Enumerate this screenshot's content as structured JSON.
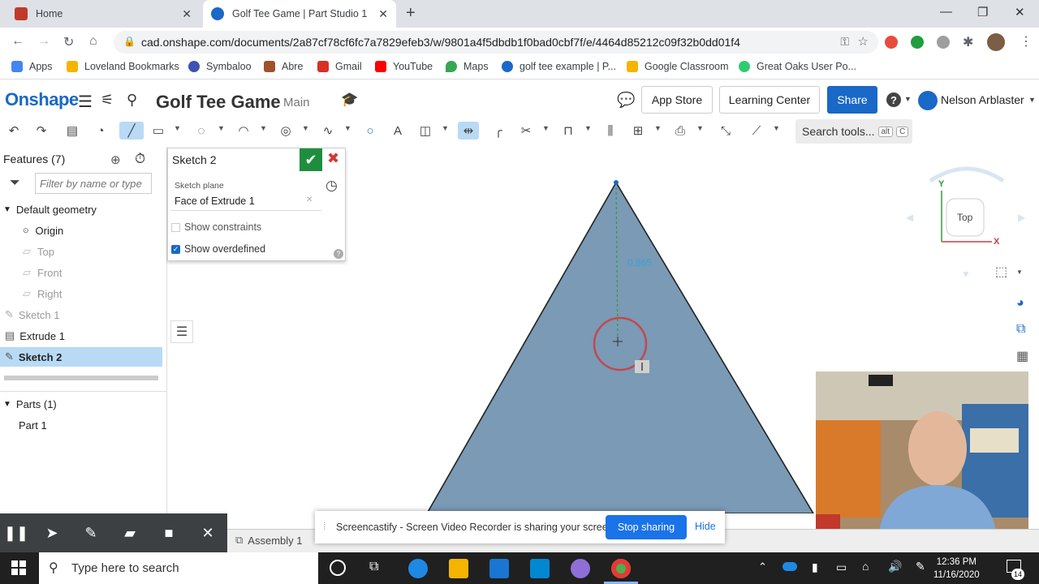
{
  "browser": {
    "tabs": [
      {
        "title": "Home",
        "favicon_color": "#c0392b"
      },
      {
        "title": "Golf Tee Game | Part Studio 1",
        "favicon_color": "#1a68c7"
      }
    ],
    "new_tab_glyph": "+",
    "url": "cad.onshape.com/documents/2a87cf78cf6fc7a7829efeb3/w/9801a4f5dbdb1f0bad0cbf7f/e/4464d85212c09f32b0dd01f4"
  },
  "bookmarks": [
    {
      "label": "Apps",
      "color": "#4285f4"
    },
    {
      "label": "Loveland Bookmarks",
      "color": "#f4b400"
    },
    {
      "label": "Symbaloo",
      "color": "#3f51b5"
    },
    {
      "label": "Abre",
      "color": "#a0522d"
    },
    {
      "label": "Gmail",
      "color": "#d93025"
    },
    {
      "label": "YouTube",
      "color": "#ff0000"
    },
    {
      "label": "Maps",
      "color": "#34a853"
    },
    {
      "label": "golf tee example | P...",
      "color": "#1a68c7"
    },
    {
      "label": "Google Classroom",
      "color": "#f4b400"
    },
    {
      "label": "Great Oaks User Po...",
      "color": "#2ecc71"
    }
  ],
  "onshape": {
    "logo": "Onshape",
    "doc_title": "Golf Tee Game",
    "branch": "Main",
    "app_store": "App Store",
    "learning_center": "Learning Center",
    "share": "Share",
    "help": "?",
    "user": "Nelson Arblaster",
    "search_tools": "Search tools...",
    "search_kbd1": "alt",
    "search_kbd2": "C"
  },
  "features": {
    "header": "Features (7)",
    "filter_placeholder": "Filter by name or type",
    "default_geometry": "Default geometry",
    "origin": "Origin",
    "top": "Top",
    "front": "Front",
    "right": "Right",
    "sketch1": "Sketch 1",
    "extrude1": "Extrude 1",
    "sketch2": "Sketch 2",
    "parts_header": "Parts (1)",
    "part1": "Part 1"
  },
  "sketch_panel": {
    "title": "Sketch 2",
    "plane_label": "Sketch plane",
    "plane_value": "Face of Extrude 1",
    "show_constraints": "Show constraints",
    "show_overdefined": "Show overdefined",
    "help": "?"
  },
  "canvas": {
    "dimension": "0.865",
    "view_cube_label": "Top",
    "axis_y": "Y",
    "axis_x": "X",
    "accent": "#7a9ab5"
  },
  "screencastify": {
    "message": "Screencastify - Screen Video Recorder is sharing your screen.",
    "stop": "Stop sharing",
    "hide": "Hide"
  },
  "bottom_tabs": {
    "assembly": "Assembly 1"
  },
  "taskbar": {
    "search_placeholder": "Type here to search",
    "time": "12:36 PM",
    "date": "11/16/2020",
    "notifications": "14"
  }
}
